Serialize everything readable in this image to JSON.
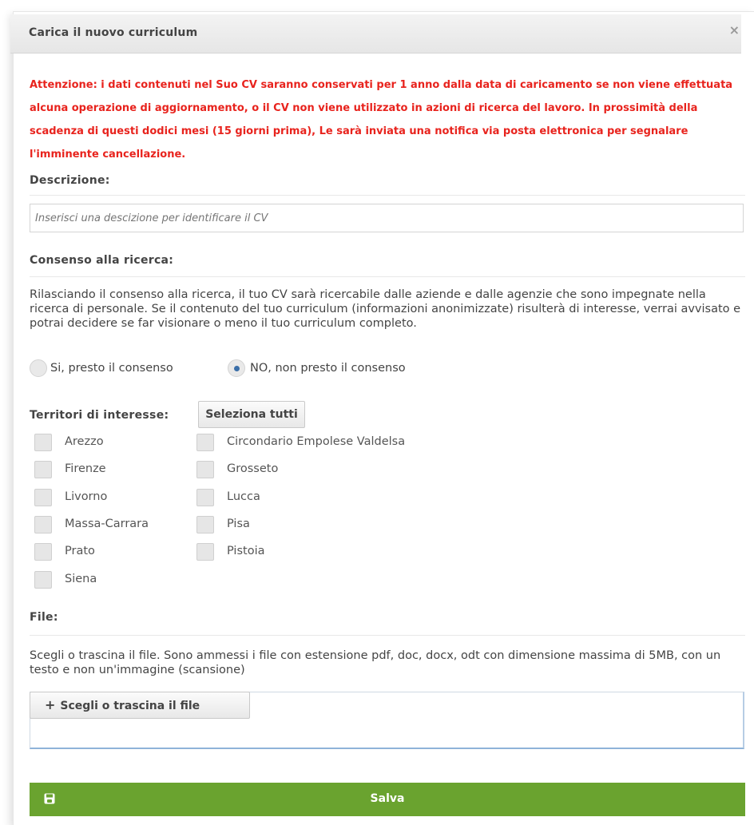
{
  "dialog": {
    "title": "Carica il nuovo curriculum",
    "close_symbol": "×"
  },
  "warning": "Attenzione: i dati contenuti nel Suo CV saranno conservati per 1 anno dalla data di caricamento se non viene effettuata alcuna operazione di aggiornamento, o il CV non viene utilizzato in azioni di ricerca del lavoro. In prossimità della scadenza di questi dodici mesi (15 giorni prima), Le sarà inviata una notifica via posta elettronica per segnalare l'imminente cancellazione.",
  "description": {
    "label": "Descrizione:",
    "placeholder": "Inserisci una descizione per identificare il CV",
    "value": ""
  },
  "consent": {
    "label": "Consenso alla ricerca:",
    "text": "Rilasciando il consenso alla ricerca, il tuo CV sarà ricercabile dalle aziende e dalle agenzie che sono impegnate nella ricerca di personale. Se il contenuto del tuo curriculum (informazioni anonimizzate) risulterà di interesse, verrai avvisato e potrai decidere se far visionare o meno il tuo curriculum completo.",
    "options": [
      {
        "label": "Si, presto il consenso",
        "selected": false
      },
      {
        "label": "NO, non presto il consenso",
        "selected": true
      }
    ]
  },
  "territories": {
    "label": "Territori di interesse:",
    "select_all_label": "Seleziona tutti",
    "items": [
      {
        "label": "Arezzo",
        "checked": false
      },
      {
        "label": "Circondario Empolese Valdelsa",
        "checked": false
      },
      {
        "label": "Firenze",
        "checked": false
      },
      {
        "label": "Grosseto",
        "checked": false
      },
      {
        "label": "Livorno",
        "checked": false
      },
      {
        "label": "Lucca",
        "checked": false
      },
      {
        "label": "Massa-Carrara",
        "checked": false
      },
      {
        "label": "Pisa",
        "checked": false
      },
      {
        "label": "Prato",
        "checked": false
      },
      {
        "label": "Pistoia",
        "checked": false
      },
      {
        "label": "Siena",
        "checked": false
      }
    ]
  },
  "file": {
    "label": "File:",
    "help": "Scegli o trascina il file. Sono ammessi i file con estensione pdf, doc, docx, odt con dimensione massima di 5MB, con un testo e non un'immagine (scansione)",
    "button_label": "Scegli o trascina il file",
    "button_icon": "+"
  },
  "save": {
    "label": "Salva",
    "icon": "save-icon"
  },
  "colors": {
    "warning": "#e8231d",
    "save_button": "#6aa32f"
  }
}
